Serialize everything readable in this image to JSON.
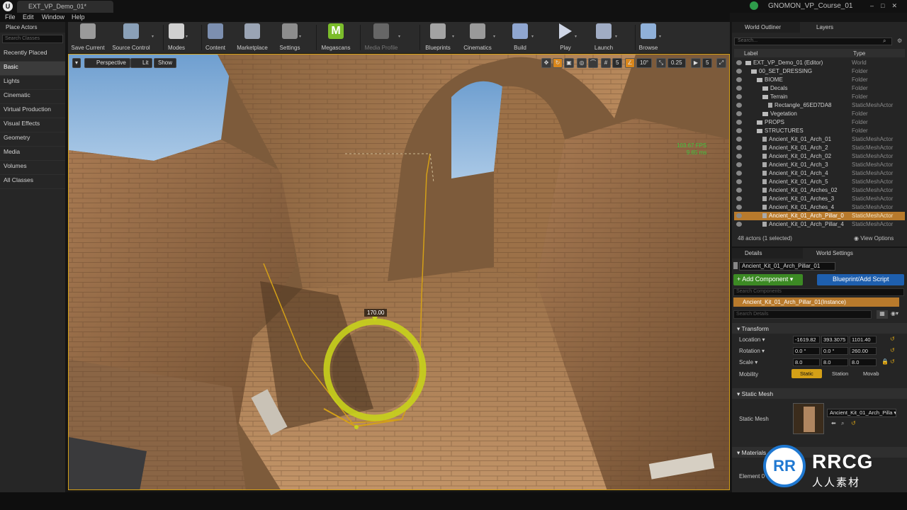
{
  "window": {
    "doc_tab": "EXT_VP_Demo_01*",
    "project": "GNOMON_VP_Course_01",
    "controls": "–□✕"
  },
  "menu": [
    "File",
    "Edit",
    "Window",
    "Help"
  ],
  "place_actors": {
    "tab": "Place Actors",
    "search_placeholder": "Search Classes",
    "categories": [
      "Recently Placed",
      "Basic",
      "Lights",
      "Cinematic",
      "Virtual Production",
      "Visual Effects",
      "Geometry",
      "Media",
      "Volumes",
      "All Classes"
    ],
    "active": "Basic"
  },
  "toolbar": [
    {
      "label": "Save Current",
      "icon": "save-icon"
    },
    {
      "label": "Source Control",
      "icon": "source-control-icon"
    },
    {
      "label": "Modes",
      "icon": "modes-icon"
    },
    {
      "label": "Content",
      "icon": "content-icon"
    },
    {
      "label": "Marketplace",
      "icon": "marketplace-icon"
    },
    {
      "label": "Settings",
      "icon": "settings-icon"
    },
    {
      "label": "Megascans",
      "icon": "megascans-icon"
    },
    {
      "label": "Media Profile",
      "icon": "media-profile-icon"
    },
    {
      "label": "Blueprints",
      "icon": "blueprints-icon"
    },
    {
      "label": "Cinematics",
      "icon": "cinematics-icon"
    },
    {
      "label": "Build",
      "icon": "build-icon"
    },
    {
      "label": "Play",
      "icon": "play-icon"
    },
    {
      "label": "Launch",
      "icon": "launch-icon"
    },
    {
      "label": "Browse",
      "icon": "browse-icon"
    }
  ],
  "viewport": {
    "menu_arrow": "▾",
    "perspective": "Perspective",
    "lit": "Lit",
    "show": "Show",
    "grid_snap": "5",
    "rot_snap": "10°",
    "scale_snap": "0.25",
    "cam_speed": "5",
    "fps_line1": "103.67 FPS",
    "fps_line2": "9.65 ms",
    "rotation_readout": "170.00"
  },
  "outliner": {
    "tab": "World Outliner",
    "tab2": "Layers",
    "search_placeholder": "Search...",
    "col_label": "Label",
    "col_type": "Type",
    "rows": [
      {
        "label": "EXT_VP_Demo_01 (Editor)",
        "type": "World",
        "indent": 1,
        "kind": "world"
      },
      {
        "label": "00_SET_DRESSING",
        "type": "Folder",
        "indent": 2,
        "kind": "folder"
      },
      {
        "label": "BIOME",
        "type": "Folder",
        "indent": 3,
        "kind": "folder"
      },
      {
        "label": "Decals",
        "type": "Folder",
        "indent": 4,
        "kind": "folder"
      },
      {
        "label": "Terrain",
        "type": "Folder",
        "indent": 4,
        "kind": "folder"
      },
      {
        "label": "Rectangle_65ED7DA8",
        "type": "StaticMeshActor",
        "indent": 5,
        "kind": "mesh"
      },
      {
        "label": "Vegetation",
        "type": "Folder",
        "indent": 4,
        "kind": "folder"
      },
      {
        "label": "PROPS",
        "type": "Folder",
        "indent": 3,
        "kind": "folder"
      },
      {
        "label": "STRUCTURES",
        "type": "Folder",
        "indent": 3,
        "kind": "folder"
      },
      {
        "label": "Ancient_Kit_01_Arch_01",
        "type": "StaticMeshActor",
        "indent": 4,
        "kind": "mesh"
      },
      {
        "label": "Ancient_Kit_01_Arch_2",
        "type": "StaticMeshActor",
        "indent": 4,
        "kind": "mesh"
      },
      {
        "label": "Ancient_Kit_01_Arch_02",
        "type": "StaticMeshActor",
        "indent": 4,
        "kind": "mesh"
      },
      {
        "label": "Ancient_Kit_01_Arch_3",
        "type": "StaticMeshActor",
        "indent": 4,
        "kind": "mesh"
      },
      {
        "label": "Ancient_Kit_01_Arch_4",
        "type": "StaticMeshActor",
        "indent": 4,
        "kind": "mesh"
      },
      {
        "label": "Ancient_Kit_01_Arch_5",
        "type": "StaticMeshActor",
        "indent": 4,
        "kind": "mesh"
      },
      {
        "label": "Ancient_Kit_01_Arches_02",
        "type": "StaticMeshActor",
        "indent": 4,
        "kind": "mesh"
      },
      {
        "label": "Ancient_Kit_01_Arches_3",
        "type": "StaticMeshActor",
        "indent": 4,
        "kind": "mesh"
      },
      {
        "label": "Ancient_Kit_01_Arches_4",
        "type": "StaticMeshActor",
        "indent": 4,
        "kind": "mesh"
      },
      {
        "label": "Ancient_Kit_01_Arch_Pillar_0",
        "type": "StaticMeshActor",
        "indent": 4,
        "kind": "mesh",
        "selected": true
      },
      {
        "label": "Ancient_Kit_01_Arch_Pillar_4",
        "type": "StaticMeshActor",
        "indent": 4,
        "kind": "mesh"
      }
    ],
    "footer": "48 actors (1 selected)",
    "view_options": "View Options"
  },
  "details": {
    "tab": "Details",
    "tab2": "World Settings",
    "actor_name": "Ancient_Kit_01_Arch_Pillar_01",
    "add_component": "+ Add Component ▾",
    "blueprint_script": "Blueprint/Add Script",
    "search_components": "Search Components",
    "instance": "Ancient_Kit_01_Arch_Pillar_01(Instance)",
    "search_details": "Search Details",
    "transform_header": "Transform",
    "location_label": "Location ▾",
    "location": [
      "-1619.82",
      "393.3075",
      "1101.40"
    ],
    "rotation_label": "Rotation ▾",
    "rotation": [
      "0.0 °",
      "0.0 °",
      "260.00"
    ],
    "scale_label": "Scale ▾",
    "scale": [
      "8.0",
      "8.0",
      "8.0"
    ],
    "mobility_label": "Mobility",
    "mobility": [
      "Static",
      "Station",
      "Movab"
    ],
    "mobility_active": "Static",
    "static_mesh_header": "Static Mesh",
    "static_mesh_label": "Static Mesh",
    "static_mesh_value": "Ancient_Kit_01_Arch_Pilla ▾",
    "materials_header": "Materials",
    "element_label": "Element 0"
  },
  "watermark": {
    "logo": "RR",
    "brand": "RRCG",
    "sub": "人人素材"
  },
  "colors": {
    "selection": "#b87a2c",
    "add_component": "#3c8a24",
    "blueprint": "#1e5fae",
    "gizmo": "#c8d11c",
    "fps": "#3fc63f"
  }
}
